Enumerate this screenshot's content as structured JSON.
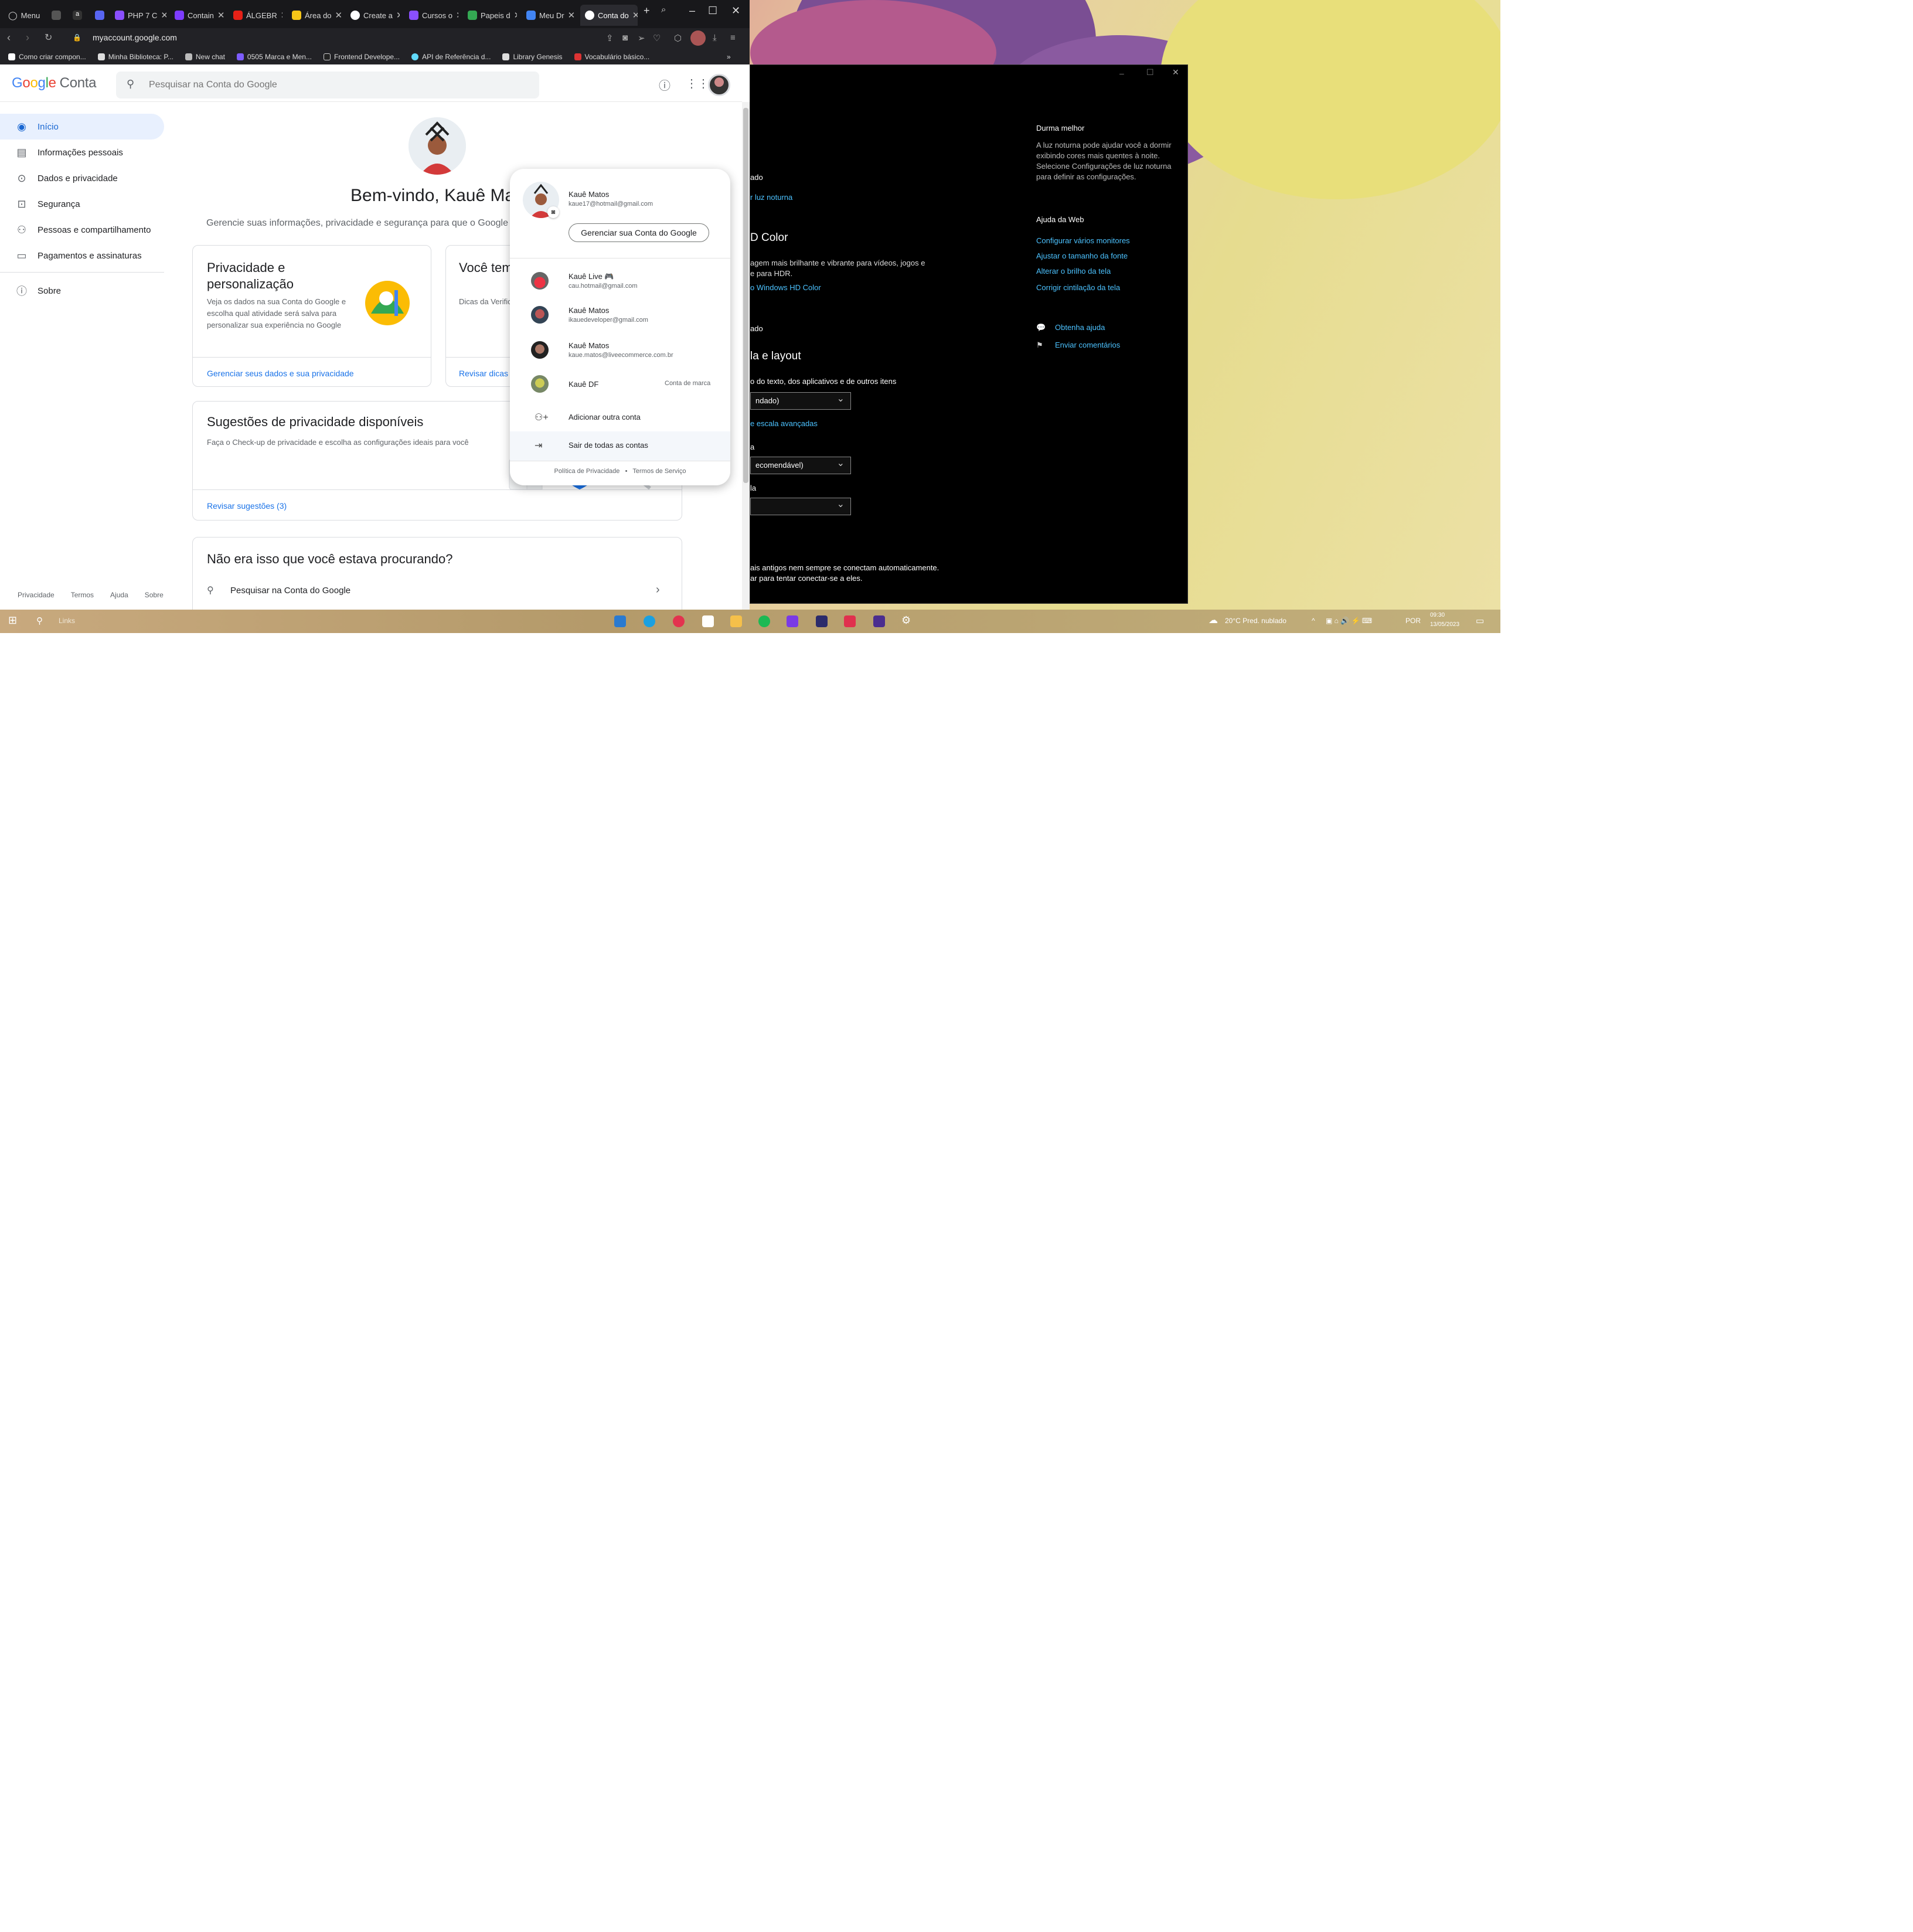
{
  "browser": {
    "menu_label": "Menu",
    "tabs": [
      "PHP 7 C",
      "Contain",
      "ÁLGEBR",
      "Área do",
      "Create a",
      "Cursos o",
      "Papeis d",
      "Meu Dr",
      "Conta do"
    ],
    "url": "myaccount.google.com",
    "bookmarks": [
      "Como criar compon...",
      "Minha Biblioteca: P...",
      "New chat",
      "0505 Marca e Men...",
      "Frontend Develope...",
      "API de Referência d...",
      "Library Genesis",
      "Vocabulário básico..."
    ]
  },
  "google": {
    "logo": {
      "g1": "G",
      "g2": "o",
      "g3": "o",
      "g4": "g",
      "g5": "l",
      "g6": "e",
      "product": "Conta"
    },
    "search_placeholder": "Pesquisar na Conta do Google",
    "sidebar": [
      "Início",
      "Informações pessoais",
      "Dados e privacidade",
      "Segurança",
      "Pessoas e compartilhamento",
      "Pagamentos e assinaturas",
      "Sobre"
    ],
    "sidebar_footer": [
      "Privacidade",
      "Termos",
      "Ajuda",
      "Sobre"
    ],
    "welcome": "Bem-vindo, Kauê Matos",
    "welcome_sub": "Gerencie suas informações, privacidade e segurança para que o Google",
    "card_privacy": {
      "title": "Privacidade e personalização",
      "text": "Veja os dados na sua Conta do Google e escolha qual atividade será salva para personalizar sua experiência no Google",
      "link": "Gerenciar seus dados e sua privacidade"
    },
    "card_security": {
      "title": "Você tem dicas de segurança",
      "text": "Dicas da Verificação de segurança",
      "link": "Revisar dicas de segurança"
    },
    "card_suggestions": {
      "title": "Sugestões de privacidade disponíveis",
      "text": "Faça o Check-up de privacidade e escolha as configurações ideais para você",
      "link": "Revisar sugestões (3)"
    },
    "card_search": {
      "title": "Não era isso que você estava procurando?",
      "search_label": "Pesquisar na Conta do Google"
    }
  },
  "popup": {
    "primary": {
      "name": "Kauê Matos",
      "email": "kaue17@hotmail@gmail.com"
    },
    "manage_button": "Gerenciar sua Conta do Google",
    "accounts": [
      {
        "name": "Kauê Live 🎮",
        "email": "cau.hotmail@gmail.com",
        "tag": ""
      },
      {
        "name": "Kauê Matos",
        "email": "ikauedeveloper@gmail.com",
        "tag": ""
      },
      {
        "name": "Kauê Matos",
        "email": "kaue.matos@liveecommerce.com.br",
        "tag": ""
      },
      {
        "name": "Kauê DF",
        "email": "",
        "tag": "Conta de marca"
      }
    ],
    "add_account": "Adicionar outra conta",
    "sign_out": "Sair de todas as contas",
    "footer": {
      "privacy": "Política de Privacidade",
      "dot": "•",
      "terms": "Termos de Serviço"
    }
  },
  "settings": {
    "partial": {
      "s1": "ado",
      "link1": "r luz noturna",
      "hd_title": "D Color",
      "hd_text1": "agem mais brilhante e vibrante para vídeos, jogos e",
      "hd_text2": "e para HDR.",
      "hd_link": "o Windows HD Color",
      "s2": "ado",
      "scale_title": "la e layout",
      "scale_text": "o do texto, dos aplicativos e de outros itens",
      "select1": "ndado)",
      "scale_link": "e escala avançadas",
      "s3": "a",
      "select2": "ecomendável)",
      "s4": "la",
      "select3": "",
      "old1": "ais antigos nem sempre se conectam automaticamente.",
      "old2": "ar para tentar conectar-se a eles."
    },
    "sleep_title": "Durma melhor",
    "sleep_text": "A luz noturna pode ajudar você a dormir exibindo cores mais quentes à noite. Selecione Configurações de luz noturna para definir as configurações.",
    "web_help_title": "Ajuda da Web",
    "web_links": [
      "Configurar vários monitores",
      "Ajustar o tamanho da fonte",
      "Alterar o brilho da tela",
      "Corrigir cintilação da tela"
    ],
    "get_help": "Obtenha ajuda",
    "feedback": "Enviar comentários"
  },
  "taskbar": {
    "search_placeholder": "Links",
    "weather": "20°C  Pred. nublado",
    "lang": "POR",
    "time": "09:30",
    "date": "13/05/2023"
  }
}
